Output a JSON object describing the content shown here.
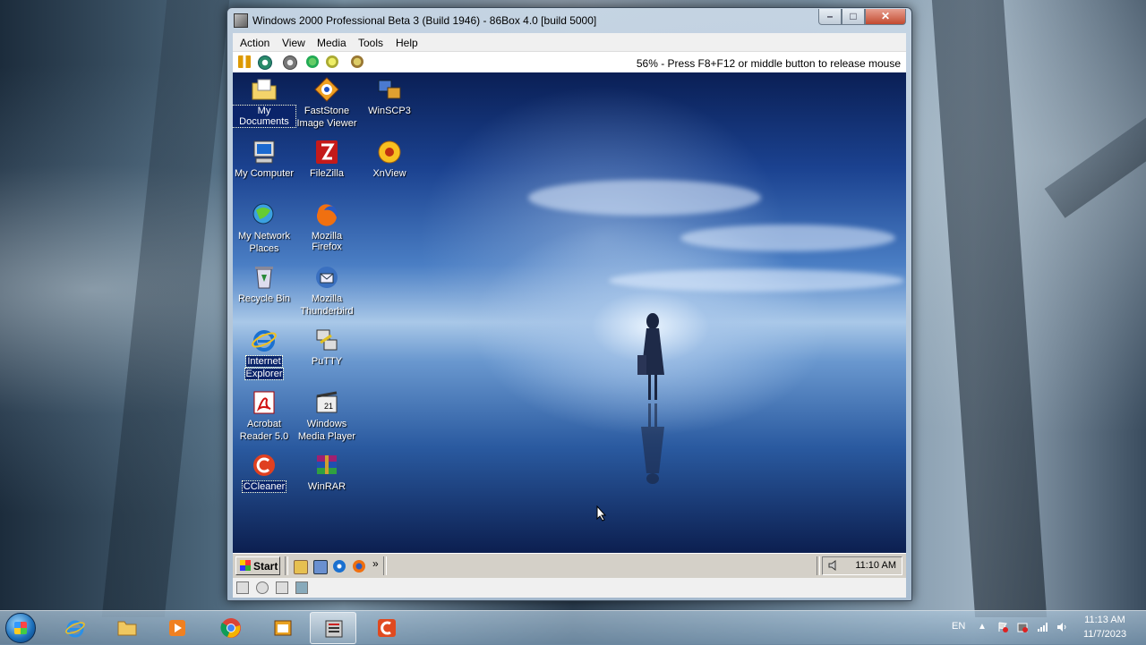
{
  "vm_window": {
    "title": "Windows 2000 Professional Beta 3 (Build 1946) - 86Box 4.0 [build 5000]",
    "menu": [
      "Action",
      "View",
      "Media",
      "Tools",
      "Help"
    ],
    "status_text": "56% - Press F8+F12 or middle button to release mouse"
  },
  "guest": {
    "desktop_icons": [
      {
        "label_1": "My Documents",
        "label_2": "",
        "icon": "folder-documents-icon"
      },
      {
        "label_1": "FastStone",
        "label_2": "Image Viewer",
        "icon": "faststone-icon"
      },
      {
        "label_1": "WinSCP3",
        "label_2": "",
        "icon": "winscp-icon"
      },
      {
        "label_1": "My Computer",
        "label_2": "",
        "icon": "my-computer-icon"
      },
      {
        "label_1": "FileZilla",
        "label_2": "",
        "icon": "filezilla-icon"
      },
      {
        "label_1": "XnView",
        "label_2": "",
        "icon": "xnview-icon"
      },
      {
        "label_1": "My Network",
        "label_2": "Places",
        "icon": "network-places-icon"
      },
      {
        "label_1": "Mozilla Firefox",
        "label_2": "",
        "icon": "firefox-icon"
      },
      {
        "label_1": "Recycle Bin",
        "label_2": "",
        "icon": "recycle-bin-icon"
      },
      {
        "label_1": "Mozilla",
        "label_2": "Thunderbird",
        "icon": "thunderbird-icon"
      },
      {
        "label_1": "Internet",
        "label_2": "Explorer",
        "icon": "internet-explorer-icon"
      },
      {
        "label_1": "PuTTY",
        "label_2": "",
        "icon": "putty-icon"
      },
      {
        "label_1": "Acrobat",
        "label_2": "Reader 5.0",
        "icon": "acrobat-reader-icon"
      },
      {
        "label_1": "Windows",
        "label_2": "Media Player",
        "icon": "media-player-icon"
      },
      {
        "label_1": "CCleaner",
        "label_2": "",
        "icon": "ccleaner-icon"
      },
      {
        "label_1": "WinRAR",
        "label_2": "",
        "icon": "winrar-icon"
      }
    ],
    "taskbar": {
      "start_label": "Start",
      "quick_launch_more": "»",
      "clock": "11:10 AM"
    }
  },
  "host_taskbar": {
    "language": "EN",
    "tray_expand": "▲",
    "time": "11:13 AM",
    "date": "11/7/2023"
  },
  "colors": {
    "guest_selection": "#0a246a",
    "classic_gray": "#d4d0c8"
  }
}
